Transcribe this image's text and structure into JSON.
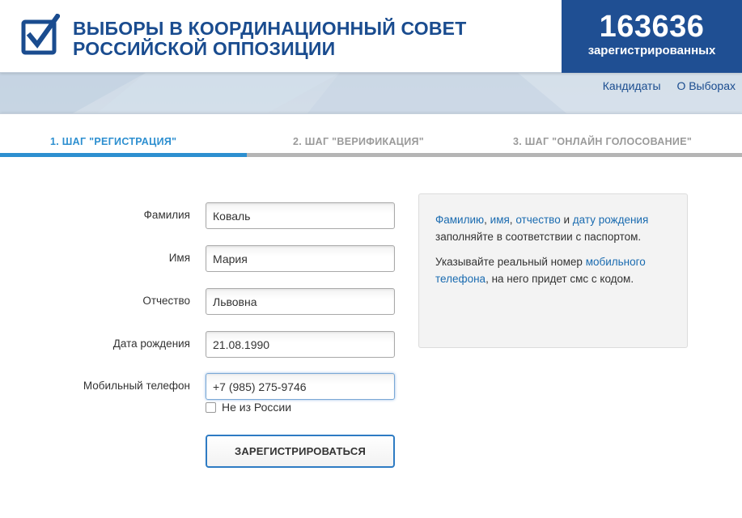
{
  "header": {
    "title_line1": "ВЫБОРЫ В КООРДИНАЦИОННЫЙ СОВЕТ",
    "title_line2": "РОССИЙСКОЙ ОППОЗИЦИИ",
    "counter_value": "163636",
    "counter_label": "зарегистрированных"
  },
  "nav": {
    "candidates": "Кандидаты",
    "about": "О Выборах"
  },
  "steps": [
    {
      "label": "1. ШАГ \"РЕГИСТРАЦИЯ\"",
      "active": true
    },
    {
      "label": "2. ШАГ \"ВЕРИФИКАЦИЯ\"",
      "active": false
    },
    {
      "label": "3. ШАГ \"ОНЛАЙН ГОЛОСОВАНИЕ\"",
      "active": false
    }
  ],
  "form": {
    "surname": {
      "label": "Фамилия",
      "value": "Коваль"
    },
    "name": {
      "label": "Имя",
      "value": "Мария"
    },
    "patronymic": {
      "label": "Отчество",
      "value": "Львовна"
    },
    "birthdate": {
      "label": "Дата рождения",
      "value": "21.08.1990"
    },
    "phone": {
      "label": "Мобильный телефон",
      "value": "+7 (985) 275-9746"
    },
    "not_russia_label": "Не из России",
    "not_russia_checked": false,
    "submit_label": "ЗАРЕГИСТРИРОВАТЬСЯ"
  },
  "info": {
    "p1_link1": "Фамилию",
    "p1_sep1": ", ",
    "p1_link2": "имя",
    "p1_sep2": ", ",
    "p1_link3": "отчество",
    "p1_sep3": " и ",
    "p1_link4": "дату рождения",
    "p1_rest": " заполняйте в соответствии с паспортом.",
    "p2_start": "Указывайте реальный номер ",
    "p2_link": "мобильного телефона",
    "p2_rest": ", на него придет смс с кодом."
  },
  "colors": {
    "brand_blue": "#1f4f93",
    "step_active": "#2d8fd0",
    "step_inactive": "#9a9a9a",
    "link": "#1a6bb0"
  }
}
